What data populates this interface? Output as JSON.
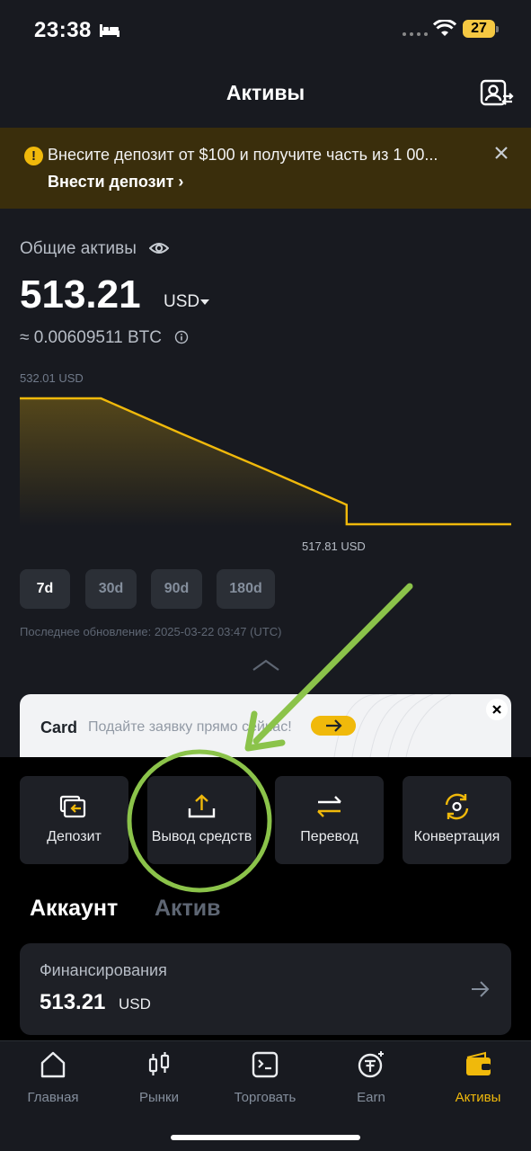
{
  "status": {
    "time": "23:38",
    "battery": "27"
  },
  "header": {
    "title": "Активы"
  },
  "banner": {
    "text": "Внесите депозит от $100 и получите часть из 1 00...",
    "link": "Внести депозит ›"
  },
  "totals": {
    "label": "Общие активы",
    "value": "513.21",
    "currency": "USD",
    "btc": "≈ 0.00609511 BTC"
  },
  "chart_data": {
    "type": "area",
    "x": [
      0,
      1,
      2,
      3,
      4,
      5,
      6
    ],
    "values": [
      532.01,
      532.01,
      528.0,
      524.0,
      520.0,
      517.81,
      517.81
    ],
    "max_label": "532.01 USD",
    "min_label": "517.81 USD",
    "ylim": [
      517.81,
      532.01
    ],
    "grid": false,
    "color": "#f0b90b"
  },
  "periods": [
    "7d",
    "30d",
    "90d",
    "180d"
  ],
  "updated": "Последнее обновление: 2025-03-22 03:47 (UTC)",
  "promo": {
    "title": "Card",
    "text": "Подайте заявку прямо сейчас!"
  },
  "actions": [
    {
      "label": "Депозит",
      "icon": "deposit-icon"
    },
    {
      "label": "Вывод средств",
      "icon": "withdraw-icon"
    },
    {
      "label": "Перевод",
      "icon": "transfer-icon"
    },
    {
      "label": "Конвертация",
      "icon": "convert-icon"
    }
  ],
  "tabs": {
    "account": "Аккаунт",
    "asset": "Актив"
  },
  "funding": {
    "label": "Финансирования",
    "value": "513.21",
    "currency": "USD"
  },
  "nav": [
    {
      "label": "Главная",
      "icon": "home-icon"
    },
    {
      "label": "Рынки",
      "icon": "markets-icon"
    },
    {
      "label": "Торговать",
      "icon": "trade-icon"
    },
    {
      "label": "Earn",
      "icon": "earn-icon"
    },
    {
      "label": "Активы",
      "icon": "wallet-icon"
    }
  ],
  "colors": {
    "accent": "#f0b90b",
    "background": "#181a20",
    "annotation": "#8bc34a"
  }
}
